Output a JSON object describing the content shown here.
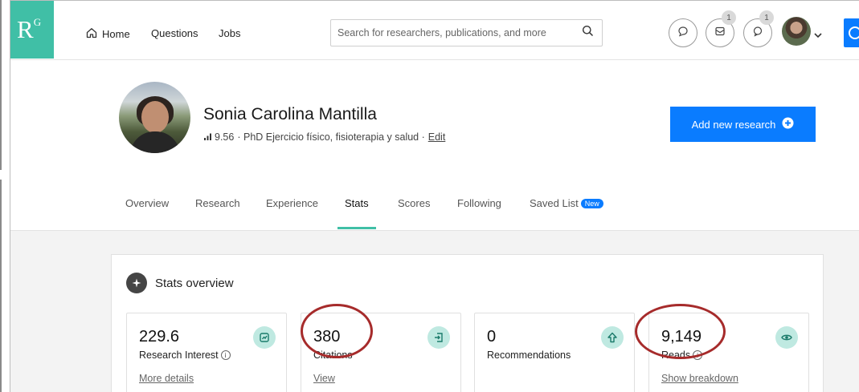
{
  "nav": {
    "logo": "R",
    "logo_sup": "G",
    "home": "Home",
    "questions": "Questions",
    "jobs": "Jobs",
    "search_placeholder": "Search for researchers, publications, and more",
    "messages_badge": "1",
    "notifications_badge": "1"
  },
  "profile": {
    "name": "Sonia Carolina Mantilla",
    "score": "9.56",
    "subtitle": "· PhD Ejercicio físico, fisioterapia y salud ·",
    "edit": "Edit",
    "add_research": "Add new research"
  },
  "tabs": [
    {
      "label": "Overview"
    },
    {
      "label": "Research"
    },
    {
      "label": "Experience"
    },
    {
      "label": "Stats"
    },
    {
      "label": "Scores"
    },
    {
      "label": "Following"
    },
    {
      "label": "Saved List",
      "badge": "New"
    }
  ],
  "active_tab": "Stats",
  "stats": {
    "heading": "Stats overview",
    "cards": [
      {
        "value": "229.6",
        "label": "Research Interest",
        "link": "More details",
        "icon": "research-interest-icon"
      },
      {
        "value": "380",
        "label": "Citations",
        "link": "View",
        "icon": "citation-icon"
      },
      {
        "value": "0",
        "label": "Recommendations",
        "link": "",
        "icon": "arrow-up-icon"
      },
      {
        "value": "9,149",
        "label": "Reads",
        "link": "Show breakdown",
        "icon": "eye-icon"
      }
    ]
  },
  "colors": {
    "brand_green": "#40bfa6",
    "primary_blue": "#0a7cff",
    "highlight_ring": "#a62b2b",
    "stat_icon_bg": "#bfe9e1"
  }
}
